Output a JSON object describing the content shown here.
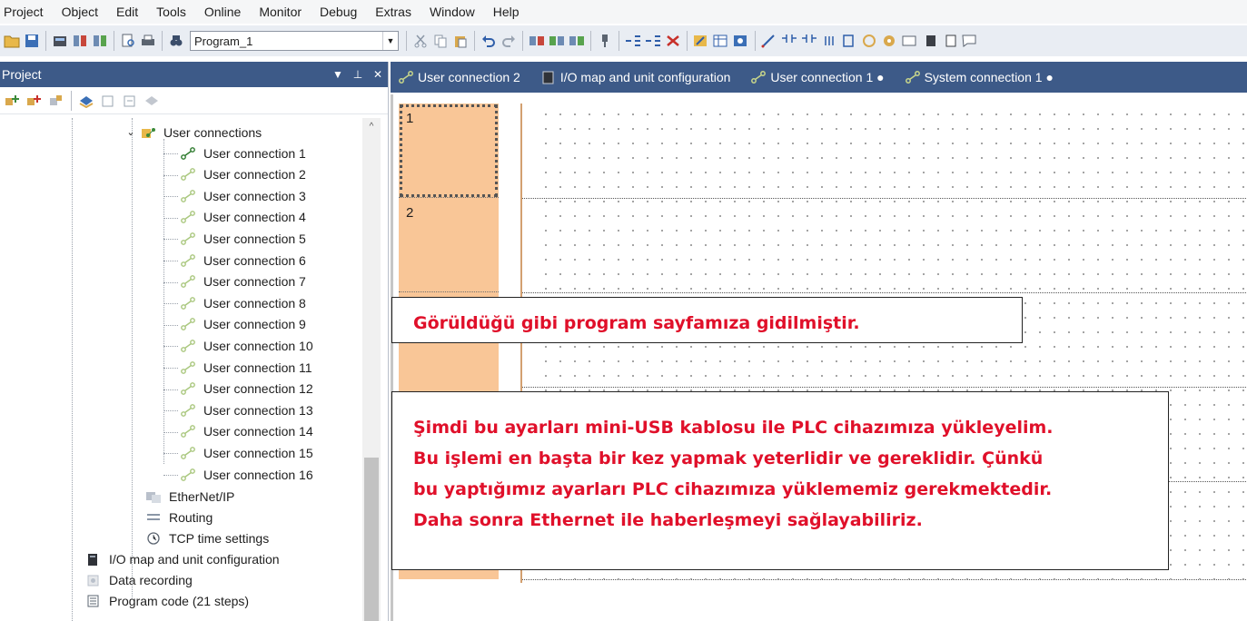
{
  "menubar": {
    "items": [
      "Project",
      "Object",
      "Edit",
      "Tools",
      "Online",
      "Monitor",
      "Debug",
      "Extras",
      "Window",
      "Help"
    ]
  },
  "toolbar": {
    "program_select_value": "Program_1"
  },
  "project_panel": {
    "title": "Project",
    "tree": {
      "user_connections_label": "User connections",
      "user_connections": [
        "User connection 1",
        "User connection 2",
        "User connection 3",
        "User connection 4",
        "User connection 5",
        "User connection 6",
        "User connection 7",
        "User connection 8",
        "User connection 9",
        "User connection 10",
        "User connection 11",
        "User connection 12",
        "User connection 13",
        "User connection 14",
        "User connection 15",
        "User connection 16"
      ],
      "ethernet_ip": "EtherNet/IP",
      "routing": "Routing",
      "tcp_time": "TCP time settings",
      "io_map": "I/O map and unit configuration",
      "data_recording": "Data recording",
      "program_code": "Program code (21 steps)"
    }
  },
  "tabs": [
    {
      "label": "User connection 2",
      "icon": "connection-icon"
    },
    {
      "label": "I/O map and unit configuration",
      "icon": "io-module-icon"
    },
    {
      "label": "User connection 1 ●",
      "icon": "connection-icon"
    },
    {
      "label": "System connection 1 ●",
      "icon": "connection-icon"
    }
  ],
  "editor": {
    "steps": [
      "1",
      "2"
    ]
  },
  "notes": {
    "note1": "Görüldüğü gibi program sayfamıza gidilmiştir.",
    "note2_lines": [
      "Şimdi bu ayarları mini-USB kablosu ile PLC cihazımıza yükleyelim.",
      "Bu işlemi en başta bir kez yapmak yeterlidir ve gereklidir. Çünkü",
      "bu yaptığımız ayarları PLC cihazımıza yüklememiz gerekmektedir.",
      "Daha sonra Ethernet ile haberleşmeyi sağlayabiliriz."
    ]
  },
  "colors": {
    "panel_header": "#3d5a88",
    "step_cell": "#f9c697",
    "note_text": "#e0102a"
  }
}
